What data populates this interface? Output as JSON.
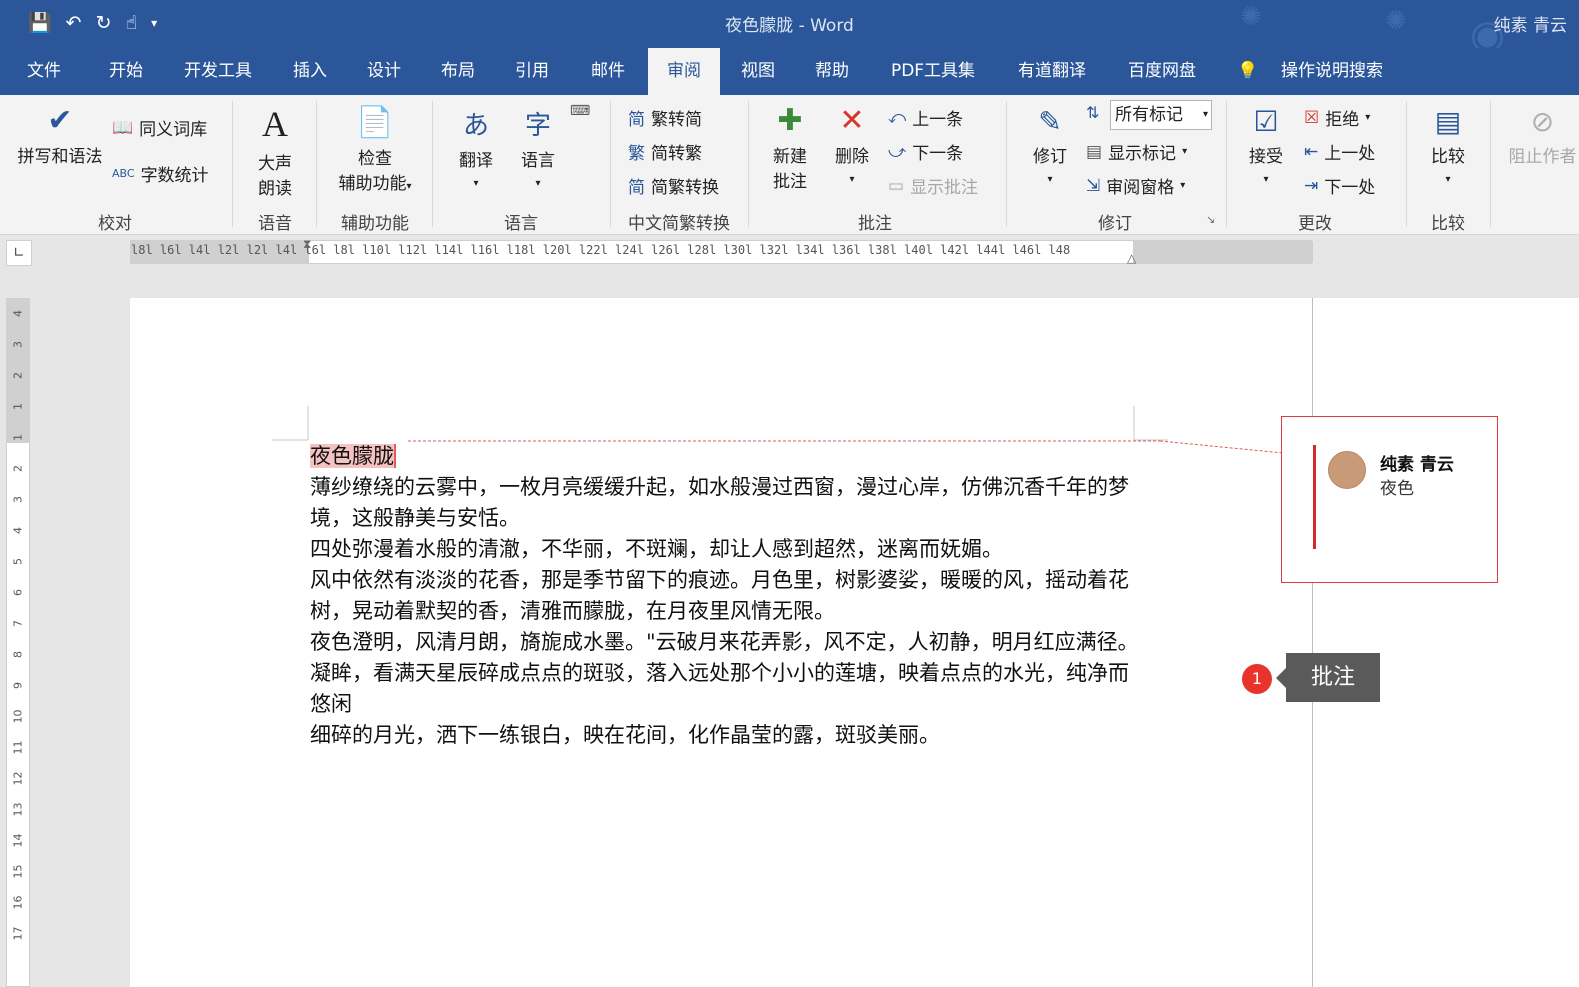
{
  "titlebar": {
    "doc_title": "夜色朦胧  -  Word",
    "user": "纯素 青云",
    "qat_icons": [
      "save-icon",
      "undo-icon",
      "redo-icon",
      "touch-mode-icon",
      "customize-icon"
    ],
    "colors": {
      "title_bg": "#2b579a"
    }
  },
  "tabs": [
    {
      "label": "文件"
    },
    {
      "label": "开始"
    },
    {
      "label": "开发工具"
    },
    {
      "label": "插入"
    },
    {
      "label": "设计"
    },
    {
      "label": "布局"
    },
    {
      "label": "引用"
    },
    {
      "label": "邮件"
    },
    {
      "label": "审阅",
      "active": true
    },
    {
      "label": "视图"
    },
    {
      "label": "帮助"
    },
    {
      "label": "PDF工具集"
    },
    {
      "label": "有道翻译"
    },
    {
      "label": "百度网盘"
    },
    {
      "label": "操作说明搜索"
    }
  ],
  "ribbon": {
    "proofing": {
      "spelling": "拼写和语法",
      "thesaurus": "同义词库",
      "word_count": "字数统计",
      "group": "校对"
    },
    "speech": {
      "read_aloud_1": "大声",
      "read_aloud_2": "朗读",
      "group": "语音"
    },
    "accessibility": {
      "check_1": "检查",
      "check_2": "辅助功能",
      "group": "辅助功能"
    },
    "language": {
      "translate": "翻译",
      "language": "语言",
      "group": "语言"
    },
    "chinese": {
      "t2s": "繁转简",
      "s2t": "简转繁",
      "convert": "简繁转换",
      "group": "中文简繁转换"
    },
    "comments": {
      "new_1": "新建",
      "new_2": "批注",
      "delete": "删除",
      "prev": "上一条",
      "next": "下一条",
      "show": "显示批注",
      "group": "批注"
    },
    "tracking": {
      "track": "修订",
      "markup_select": "所有标记",
      "show_markup": "显示标记",
      "review_pane": "审阅窗格",
      "group": "修订"
    },
    "changes": {
      "accept": "接受",
      "reject": "拒绝",
      "prev": "上一处",
      "next": "下一处",
      "group": "更改"
    },
    "compare": {
      "compare": "比较",
      "group": "比较"
    },
    "protect": {
      "block": "阻止作者"
    }
  },
  "ruler": {
    "h_ticks": "l8l l6l l4l l2l   l2l l4l l6l l8l l10l l12l l14l l16l l18l l20l l22l l24l l26l l28l l30l l32l l34l l36l l38l l40l l42l l44l l46l l48",
    "v_ticks": [
      "4",
      "3",
      "2",
      "1",
      "1",
      "2",
      "3",
      "4",
      "5",
      "6",
      "7",
      "8",
      "9",
      "10",
      "11",
      "12",
      "13",
      "14",
      "15",
      "16",
      "17"
    ]
  },
  "document": {
    "title": "夜色朦胧",
    "paragraphs": [
      "薄纱缭绕的云雾中，一枚月亮缓缓升起，如水般漫过西窗，漫过心岸，仿佛沉香千年的梦境，这般静美与安恬。",
      "四处弥漫着水般的清澈，不华丽，不斑斓，却让人感到超然，迷离而妩媚。",
      "风中依然有淡淡的花香，那是季节留下的痕迹。月色里，树影婆娑，暖暖的风，摇动着花树，晃动着默契的香，清雅而朦胧，在月夜里风情无限。",
      "夜色澄明，风清月朗，旖旎成水墨。\"云破月来花弄影，风不定，人初静，明月红应满径。",
      "凝眸，看满天星辰碎成点点的斑驳，落入远处那个小小的莲塘，映着点点的水光，纯净而悠闲",
      "细碎的月光，洒下一练银白，映在花间，化作晶莹的露，斑驳美丽。"
    ]
  },
  "comment": {
    "author": "纯素  青云",
    "text": "夜色"
  },
  "callout": {
    "badge": "1",
    "label": "批注"
  }
}
